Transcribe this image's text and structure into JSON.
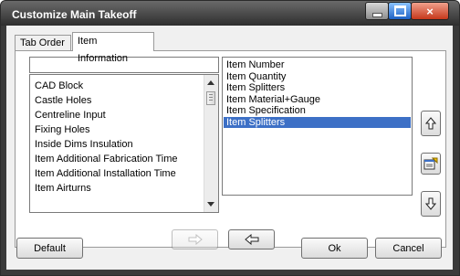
{
  "window": {
    "title": "Customize Main Takeoff",
    "close_glyph": "×"
  },
  "tabs": [
    {
      "label": "Tab Order"
    },
    {
      "label": "Item Information"
    }
  ],
  "search": {
    "value": ""
  },
  "available_items": [
    "CAD Block",
    "Castle Holes",
    "Centreline Input",
    "Fixing Holes",
    "Inside Dims Insulation",
    "Item Additional Fabrication Time",
    "Item Additional Installation Time",
    "Item Airturns"
  ],
  "selected_items": [
    "Item Number",
    "Item Quantity",
    "Item Splitters",
    "Item Material+Gauge",
    "Item Specification",
    "Item Splitters"
  ],
  "selected_index": 5,
  "buttons": {
    "default": "Default",
    "ok": "Ok",
    "cancel": "Cancel"
  },
  "icons": {
    "move_up": "arrow-up-icon",
    "properties": "properties-icon",
    "move_down": "arrow-down-icon",
    "add": "arrow-right-icon",
    "remove": "arrow-left-icon"
  },
  "colors": {
    "selection": "#3d70c6",
    "titlebar": "#2e2e2e"
  }
}
